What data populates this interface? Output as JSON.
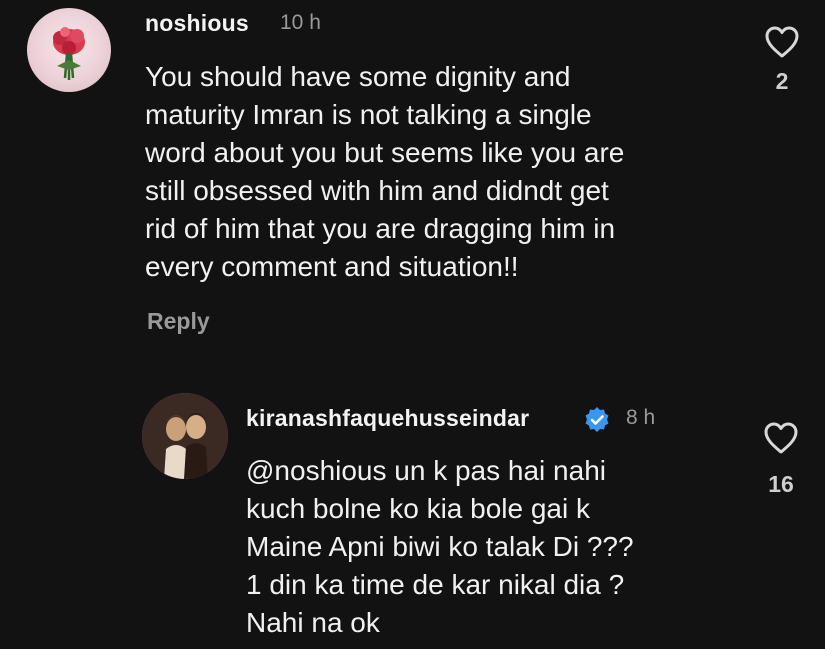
{
  "comments": [
    {
      "username": "noshious",
      "time": "10 h",
      "text": "You should have some dignity and\nmaturity Imran is not talking a single\nword about you but seems like you are\nstill obsessed with him and didndt get\nrid of him that you are dragging him in\nevery comment and situation!!",
      "reply_label": "Reply",
      "likes": "2",
      "avatar_icon": "rose-bouquet-avatar"
    },
    {
      "username": "kiranashfaquehusseindar",
      "verified": true,
      "time": "8 h",
      "text": "@noshious un k pas hai nahi\nkuch bolne ko kia bole gai k\nMaine Apni biwi ko talak Di ???\n1 din ka time de kar nikal dia ?\nNahi na ok",
      "likes": "16",
      "avatar_icon": "couple-photo-avatar",
      "verified_color": "#3897f0"
    }
  ],
  "colors": {
    "background": "#121212",
    "text": "#f1f1f1",
    "muted": "#9a9a9a"
  }
}
